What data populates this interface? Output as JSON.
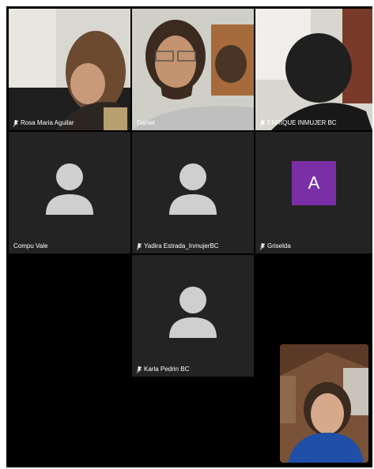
{
  "participants": [
    {
      "name": "Rosa Maria Aguilar",
      "muted": true,
      "type": "video"
    },
    {
      "name": "Daniel",
      "muted": false,
      "type": "video",
      "active_speaker": true
    },
    {
      "name": "ENRIQUE INMUJER BC",
      "muted": true,
      "type": "video"
    },
    {
      "name": "Compu Vale",
      "muted": false,
      "type": "avatar-placeholder"
    },
    {
      "name": "Yadira Estrada_InmujerBC",
      "muted": true,
      "type": "avatar-placeholder"
    },
    {
      "name": "Griselda",
      "muted": true,
      "type": "avatar-letter",
      "initial": "A",
      "avatar_color": "#7b2fa6"
    },
    {
      "name": "Karla Pedrin BC",
      "muted": true,
      "type": "avatar-placeholder"
    }
  ],
  "colors": {
    "background": "#000000",
    "tile": "#232323",
    "active_speaker_border": "#3fd14a",
    "placeholder_icon": "#cfcfcf"
  },
  "icons": {
    "muted": "mic-off-icon",
    "placeholder": "person-silhouette-icon"
  }
}
